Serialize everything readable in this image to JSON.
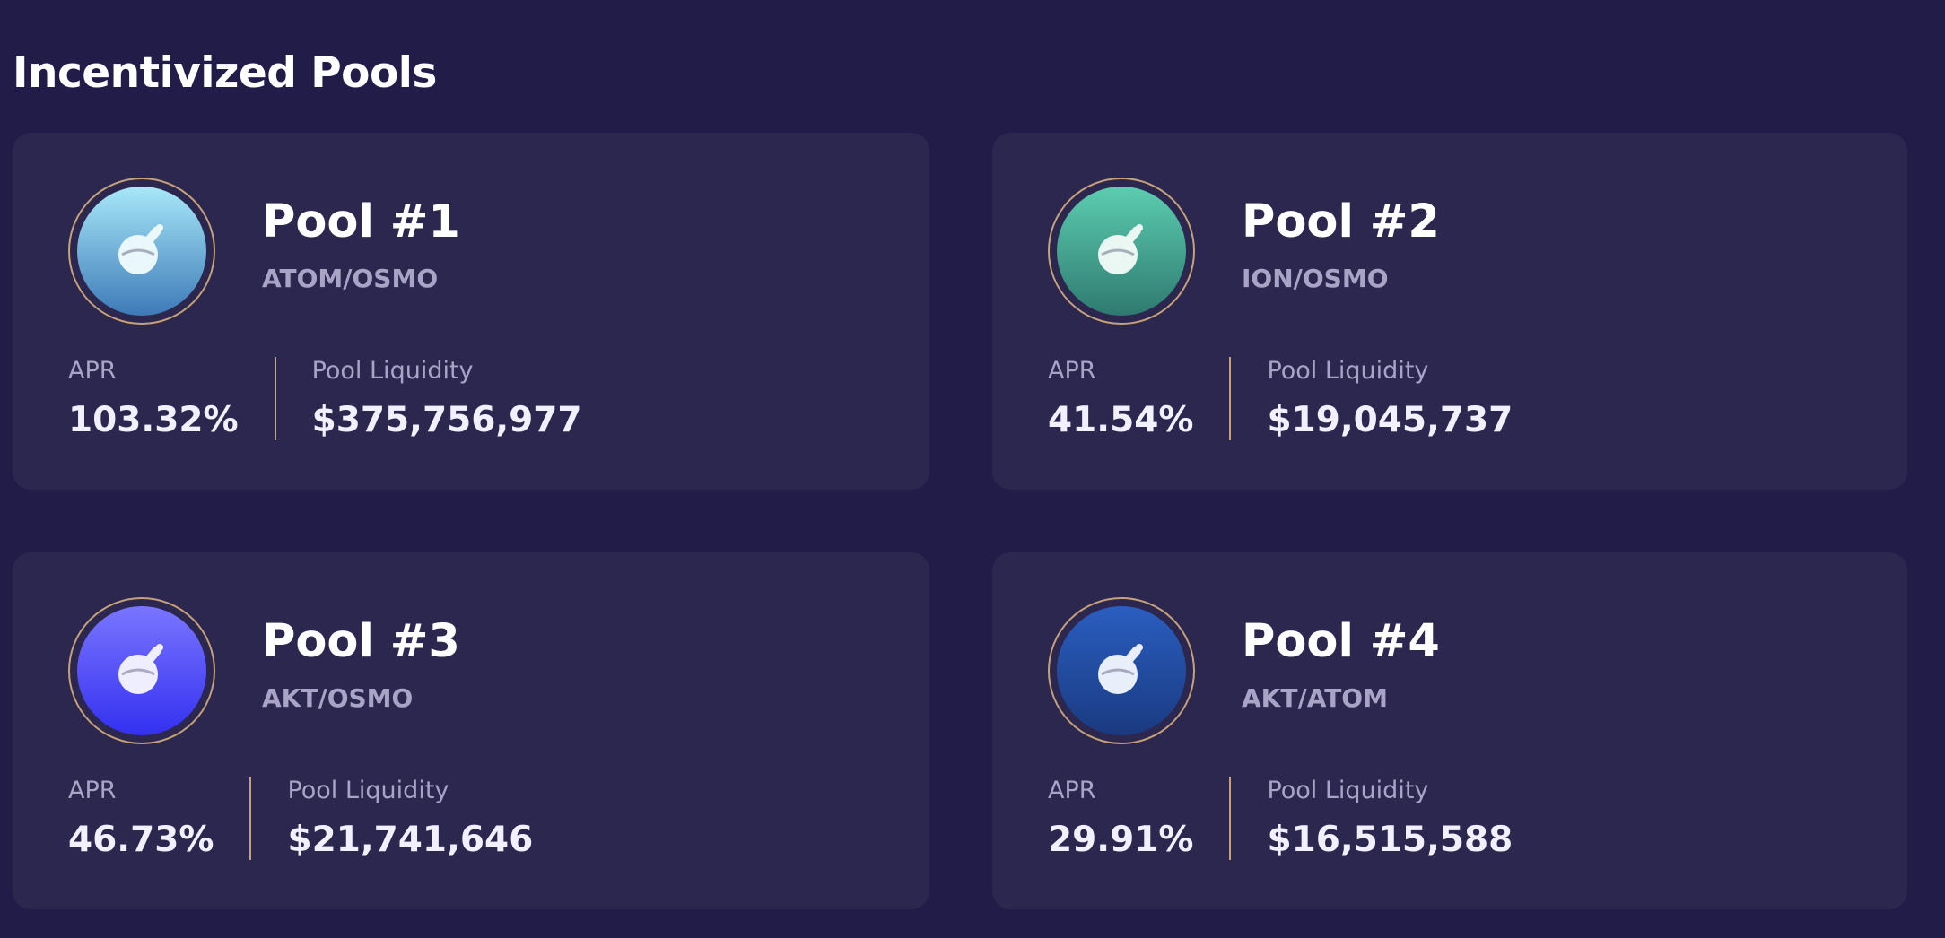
{
  "page": {
    "title": "Incentivized Pools"
  },
  "pools": [
    {
      "name": "Pool #1",
      "pair": "ATOM/OSMO",
      "apr_label": "APR",
      "apr": "103.32%",
      "liquidity_label": "Pool Liquidity",
      "liquidity": "$375,756,977",
      "icon": "osmosis-flask-icon",
      "icon_gradient": [
        "#a8e8f8",
        "#3d7ab8"
      ]
    },
    {
      "name": "Pool #2",
      "pair": "ION/OSMO",
      "apr_label": "APR",
      "apr": "41.54%",
      "liquidity_label": "Pool Liquidity",
      "liquidity": "$19,045,737",
      "icon": "osmosis-flask-icon",
      "icon_gradient": [
        "#5ccdb0",
        "#2f7a70"
      ]
    },
    {
      "name": "Pool #3",
      "pair": "AKT/OSMO",
      "apr_label": "APR",
      "apr": "46.73%",
      "liquidity_label": "Pool Liquidity",
      "liquidity": "$21,741,646",
      "icon": "osmosis-flask-icon",
      "icon_gradient": [
        "#7a76ff",
        "#3330f0"
      ]
    },
    {
      "name": "Pool #4",
      "pair": "AKT/ATOM",
      "apr_label": "APR",
      "apr": "29.91%",
      "liquidity_label": "Pool Liquidity",
      "liquidity": "$16,515,588",
      "icon": "osmosis-flask-icon",
      "icon_gradient": [
        "#2a5ec0",
        "#1a3a80"
      ]
    }
  ],
  "colors": {
    "background": "#211c48",
    "card": "#2c274f",
    "accent_gold": "#c6a27a",
    "muted_text": "#a9a4c6"
  }
}
